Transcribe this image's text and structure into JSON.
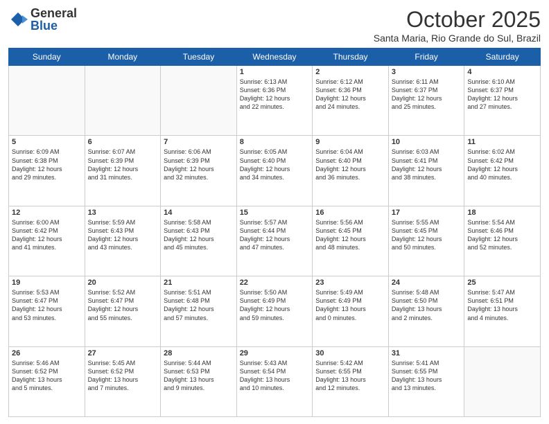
{
  "logo": {
    "general": "General",
    "blue": "Blue"
  },
  "header": {
    "month": "October 2025",
    "location": "Santa Maria, Rio Grande do Sul, Brazil"
  },
  "weekdays": [
    "Sunday",
    "Monday",
    "Tuesday",
    "Wednesday",
    "Thursday",
    "Friday",
    "Saturday"
  ],
  "weeks": [
    [
      {
        "day": "",
        "info": ""
      },
      {
        "day": "",
        "info": ""
      },
      {
        "day": "",
        "info": ""
      },
      {
        "day": "1",
        "info": "Sunrise: 6:13 AM\nSunset: 6:36 PM\nDaylight: 12 hours\nand 22 minutes."
      },
      {
        "day": "2",
        "info": "Sunrise: 6:12 AM\nSunset: 6:36 PM\nDaylight: 12 hours\nand 24 minutes."
      },
      {
        "day": "3",
        "info": "Sunrise: 6:11 AM\nSunset: 6:37 PM\nDaylight: 12 hours\nand 25 minutes."
      },
      {
        "day": "4",
        "info": "Sunrise: 6:10 AM\nSunset: 6:37 PM\nDaylight: 12 hours\nand 27 minutes."
      }
    ],
    [
      {
        "day": "5",
        "info": "Sunrise: 6:09 AM\nSunset: 6:38 PM\nDaylight: 12 hours\nand 29 minutes."
      },
      {
        "day": "6",
        "info": "Sunrise: 6:07 AM\nSunset: 6:39 PM\nDaylight: 12 hours\nand 31 minutes."
      },
      {
        "day": "7",
        "info": "Sunrise: 6:06 AM\nSunset: 6:39 PM\nDaylight: 12 hours\nand 32 minutes."
      },
      {
        "day": "8",
        "info": "Sunrise: 6:05 AM\nSunset: 6:40 PM\nDaylight: 12 hours\nand 34 minutes."
      },
      {
        "day": "9",
        "info": "Sunrise: 6:04 AM\nSunset: 6:40 PM\nDaylight: 12 hours\nand 36 minutes."
      },
      {
        "day": "10",
        "info": "Sunrise: 6:03 AM\nSunset: 6:41 PM\nDaylight: 12 hours\nand 38 minutes."
      },
      {
        "day": "11",
        "info": "Sunrise: 6:02 AM\nSunset: 6:42 PM\nDaylight: 12 hours\nand 40 minutes."
      }
    ],
    [
      {
        "day": "12",
        "info": "Sunrise: 6:00 AM\nSunset: 6:42 PM\nDaylight: 12 hours\nand 41 minutes."
      },
      {
        "day": "13",
        "info": "Sunrise: 5:59 AM\nSunset: 6:43 PM\nDaylight: 12 hours\nand 43 minutes."
      },
      {
        "day": "14",
        "info": "Sunrise: 5:58 AM\nSunset: 6:43 PM\nDaylight: 12 hours\nand 45 minutes."
      },
      {
        "day": "15",
        "info": "Sunrise: 5:57 AM\nSunset: 6:44 PM\nDaylight: 12 hours\nand 47 minutes."
      },
      {
        "day": "16",
        "info": "Sunrise: 5:56 AM\nSunset: 6:45 PM\nDaylight: 12 hours\nand 48 minutes."
      },
      {
        "day": "17",
        "info": "Sunrise: 5:55 AM\nSunset: 6:45 PM\nDaylight: 12 hours\nand 50 minutes."
      },
      {
        "day": "18",
        "info": "Sunrise: 5:54 AM\nSunset: 6:46 PM\nDaylight: 12 hours\nand 52 minutes."
      }
    ],
    [
      {
        "day": "19",
        "info": "Sunrise: 5:53 AM\nSunset: 6:47 PM\nDaylight: 12 hours\nand 53 minutes."
      },
      {
        "day": "20",
        "info": "Sunrise: 5:52 AM\nSunset: 6:47 PM\nDaylight: 12 hours\nand 55 minutes."
      },
      {
        "day": "21",
        "info": "Sunrise: 5:51 AM\nSunset: 6:48 PM\nDaylight: 12 hours\nand 57 minutes."
      },
      {
        "day": "22",
        "info": "Sunrise: 5:50 AM\nSunset: 6:49 PM\nDaylight: 12 hours\nand 59 minutes."
      },
      {
        "day": "23",
        "info": "Sunrise: 5:49 AM\nSunset: 6:49 PM\nDaylight: 13 hours\nand 0 minutes."
      },
      {
        "day": "24",
        "info": "Sunrise: 5:48 AM\nSunset: 6:50 PM\nDaylight: 13 hours\nand 2 minutes."
      },
      {
        "day": "25",
        "info": "Sunrise: 5:47 AM\nSunset: 6:51 PM\nDaylight: 13 hours\nand 4 minutes."
      }
    ],
    [
      {
        "day": "26",
        "info": "Sunrise: 5:46 AM\nSunset: 6:52 PM\nDaylight: 13 hours\nand 5 minutes."
      },
      {
        "day": "27",
        "info": "Sunrise: 5:45 AM\nSunset: 6:52 PM\nDaylight: 13 hours\nand 7 minutes."
      },
      {
        "day": "28",
        "info": "Sunrise: 5:44 AM\nSunset: 6:53 PM\nDaylight: 13 hours\nand 9 minutes."
      },
      {
        "day": "29",
        "info": "Sunrise: 5:43 AM\nSunset: 6:54 PM\nDaylight: 13 hours\nand 10 minutes."
      },
      {
        "day": "30",
        "info": "Sunrise: 5:42 AM\nSunset: 6:55 PM\nDaylight: 13 hours\nand 12 minutes."
      },
      {
        "day": "31",
        "info": "Sunrise: 5:41 AM\nSunset: 6:55 PM\nDaylight: 13 hours\nand 13 minutes."
      },
      {
        "day": "",
        "info": ""
      }
    ]
  ]
}
